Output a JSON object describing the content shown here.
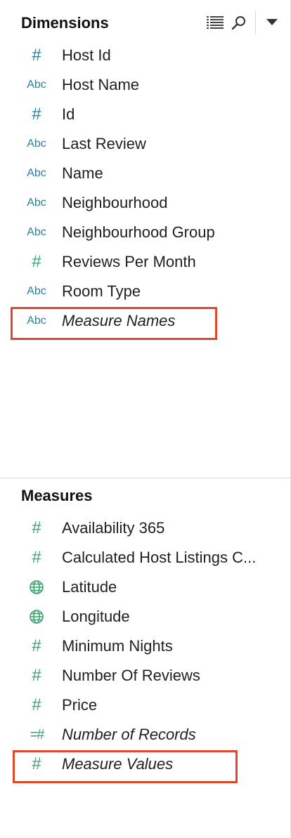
{
  "dimensions": {
    "title": "Dimensions",
    "items": [
      {
        "label": "Host Id",
        "icon": "hash-icon",
        "color": "#2b7f97"
      },
      {
        "label": "Host Name",
        "icon": "abc-icon"
      },
      {
        "label": "Id",
        "icon": "hash-icon",
        "color": "#2b7f97"
      },
      {
        "label": "Last Review",
        "icon": "abc-icon"
      },
      {
        "label": "Name",
        "icon": "abc-icon"
      },
      {
        "label": "Neighbourhood",
        "icon": "abc-icon"
      },
      {
        "label": "Neighbourhood Group",
        "icon": "abc-icon"
      },
      {
        "label": "Reviews Per Month",
        "icon": "hash-icon",
        "color": "#3aa46f"
      },
      {
        "label": "Room Type",
        "icon": "abc-icon"
      },
      {
        "label": "Measure Names",
        "icon": "abc-icon",
        "italic": true,
        "highlighted": true
      }
    ],
    "abc_text": "Abc"
  },
  "measures": {
    "title": "Measures",
    "items": [
      {
        "label": "Availability 365",
        "icon": "hash-icon"
      },
      {
        "label": "Calculated Host Listings C...",
        "icon": "hash-icon"
      },
      {
        "label": "Latitude",
        "icon": "globe-icon"
      },
      {
        "label": "Longitude",
        "icon": "globe-icon"
      },
      {
        "label": "Minimum Nights",
        "icon": "hash-icon"
      },
      {
        "label": "Number Of Reviews",
        "icon": "hash-icon"
      },
      {
        "label": "Price",
        "icon": "hash-icon"
      },
      {
        "label": "Number of Records",
        "icon": "eq-hash-icon",
        "italic": true
      },
      {
        "label": "Measure Values",
        "icon": "hash-icon",
        "italic": true,
        "highlighted": true
      }
    ]
  },
  "colors": {
    "dimension_blue": "#2b7f97",
    "measure_green": "#3aa46f",
    "highlight_red": "#e0472c"
  }
}
